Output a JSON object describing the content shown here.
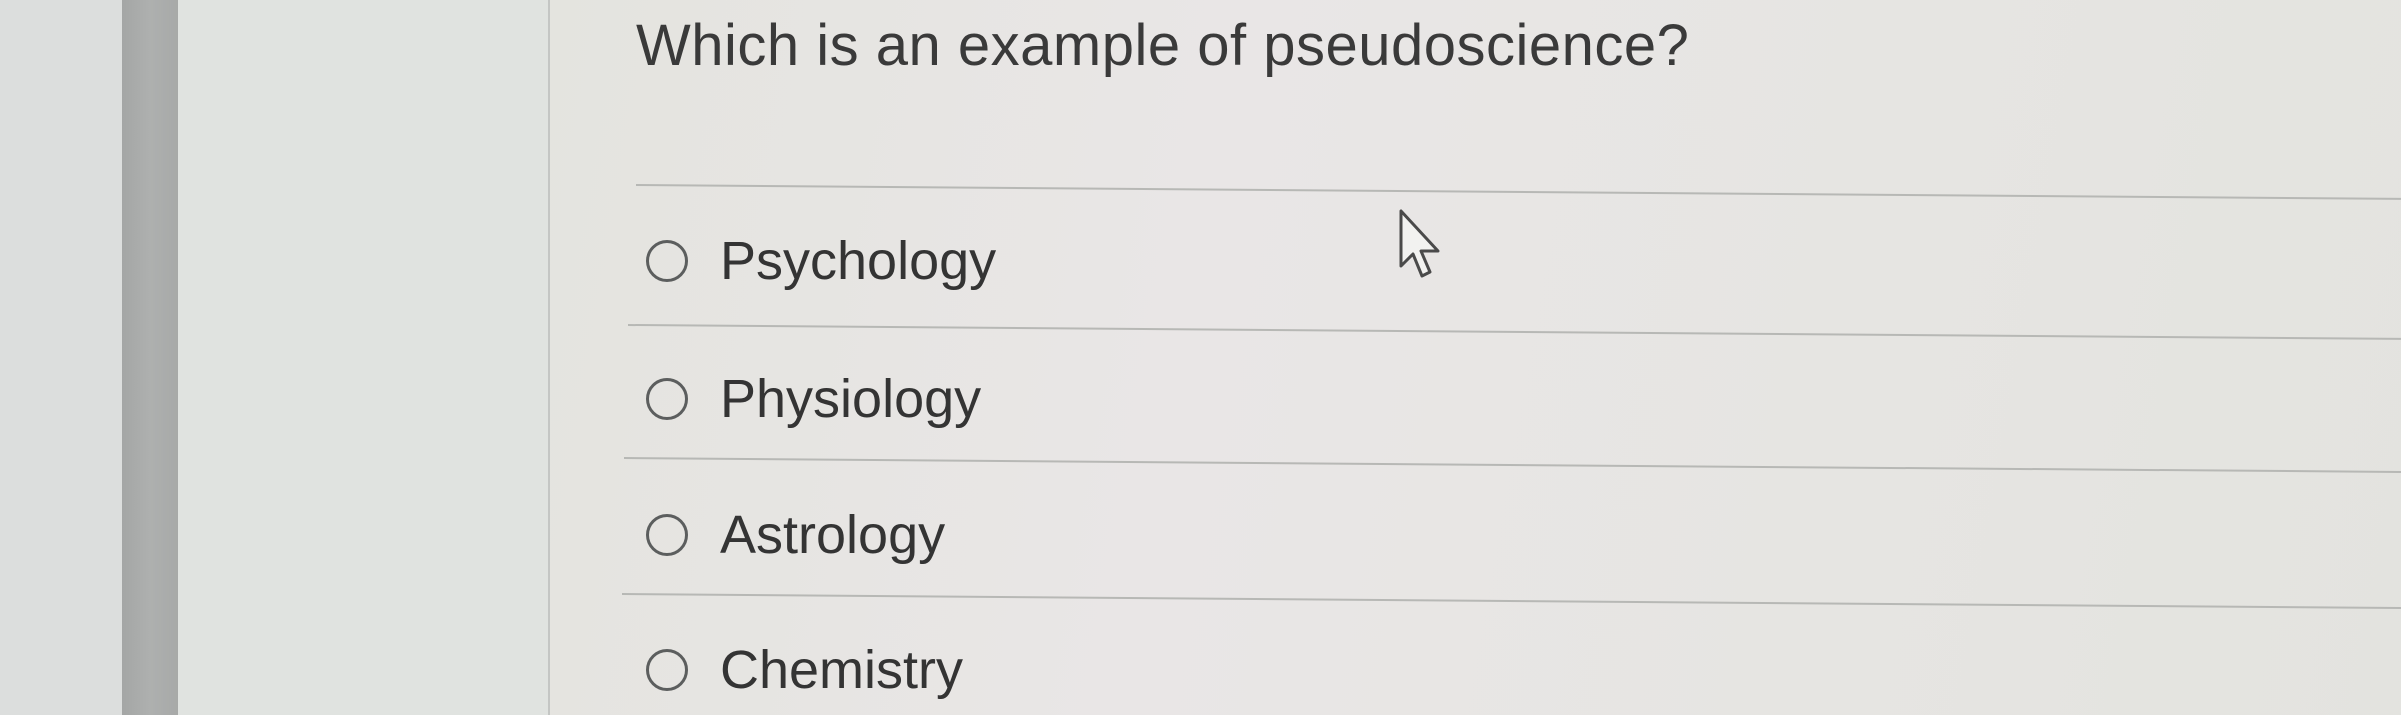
{
  "question": {
    "text": "Which is an example of pseudoscience?"
  },
  "options": [
    {
      "label": "Psychology",
      "selected": false
    },
    {
      "label": "Physiology",
      "selected": false
    },
    {
      "label": "Astrology",
      "selected": false
    },
    {
      "label": "Chemistry",
      "selected": false
    }
  ],
  "icons": {
    "radio": "radio-unselected-icon",
    "pointer": "mouse-pointer-icon"
  },
  "colors": {
    "text": "#343434",
    "radio_border": "#5c5e5e",
    "divider": "#b7b8b5"
  }
}
